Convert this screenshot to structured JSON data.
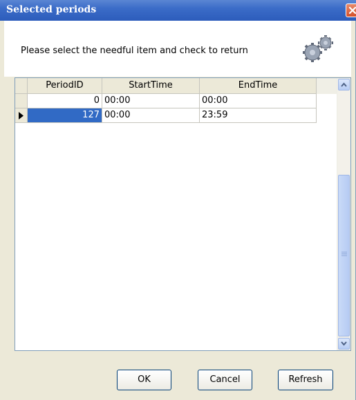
{
  "window": {
    "title": "Selected periods"
  },
  "header": {
    "message": "Please select the needful item and check to return"
  },
  "grid": {
    "columns": [
      "PeriodID",
      "StartTime",
      "EndTime"
    ],
    "rows": [
      {
        "PeriodID": "0",
        "StartTime": "00:00",
        "EndTime": "00:00",
        "selected": false
      },
      {
        "PeriodID": "127",
        "StartTime": "00:00",
        "EndTime": "23:59",
        "selected": true
      }
    ]
  },
  "buttons": {
    "ok": "OK",
    "cancel": "Cancel",
    "refresh": "Refresh"
  },
  "colors": {
    "titlebar": "#2c5cbb",
    "selection": "#316ac5",
    "dialog_bg": "#ece9d8"
  },
  "icons": [
    "close-icon",
    "gears-icon",
    "row-indicator-icon",
    "scroll-up-icon",
    "scroll-down-icon"
  ]
}
